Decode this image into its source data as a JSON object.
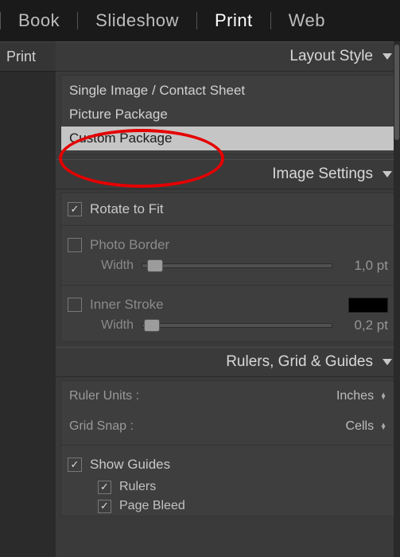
{
  "topTabs": {
    "book": "Book",
    "slideshow": "Slideshow",
    "print": "Print",
    "web": "Web"
  },
  "leftPanel": {
    "title": "Print"
  },
  "layoutStyle": {
    "title": "Layout Style",
    "items": {
      "single": "Single Image / Contact Sheet",
      "picture": "Picture Package",
      "custom": "Custom Package"
    }
  },
  "imageSettings": {
    "title": "Image Settings",
    "rotate": "Rotate to Fit",
    "photoBorder": "Photo Border",
    "widthLabel": "Width",
    "borderVal": "1,0 pt",
    "innerStroke": "Inner Stroke",
    "strokeVal": "0,2 pt"
  },
  "rulers": {
    "title": "Rulers, Grid & Guides",
    "rulerUnits": "Ruler Units :",
    "rulerVal": "Inches",
    "gridSnap": "Grid Snap :",
    "gridVal": "Cells",
    "showGuides": "Show Guides",
    "rulersItem": "Rulers",
    "pageBleed": "Page Bleed"
  }
}
